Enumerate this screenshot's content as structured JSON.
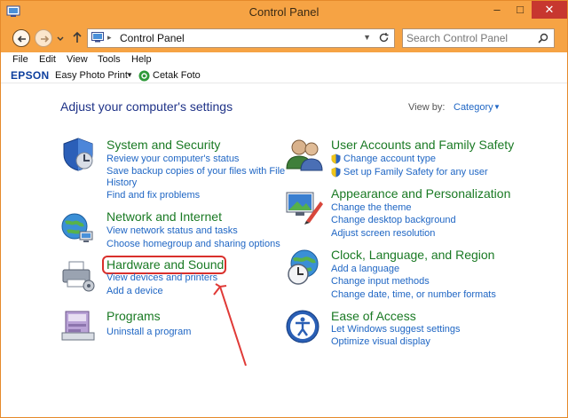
{
  "window": {
    "title": "Control Panel"
  },
  "address": {
    "path_label": "Control Panel"
  },
  "search": {
    "placeholder": "Search Control Panel"
  },
  "menu": {
    "file": "File",
    "edit": "Edit",
    "view": "View",
    "tools": "Tools",
    "help": "Help"
  },
  "epson": {
    "logo": "EPSON",
    "app": "Easy Photo Print",
    "foto": "Cetak Foto"
  },
  "heading": "Adjust your computer's settings",
  "view_by": {
    "label": "View by:",
    "value": "Category"
  },
  "categories": {
    "system": {
      "title": "System and Security",
      "links": [
        "Review your computer's status",
        "Save backup copies of your files with File",
        "History",
        "Find and fix problems"
      ]
    },
    "network": {
      "title": "Network and Internet",
      "links": [
        "View network status and tasks",
        "Choose homegroup and sharing options"
      ]
    },
    "hardware": {
      "title": "Hardware and Sound",
      "links": [
        "View devices and printers",
        "Add a device"
      ]
    },
    "programs": {
      "title": "Programs",
      "links": [
        "Uninstall a program"
      ]
    },
    "accounts": {
      "title": "User Accounts and Family Safety",
      "links": [
        "Change account type",
        "Set up Family Safety for any user"
      ]
    },
    "appearance": {
      "title": "Appearance and Personalization",
      "links": [
        "Change the theme",
        "Change desktop background",
        "Adjust screen resolution"
      ]
    },
    "clock": {
      "title": "Clock, Language, and Region",
      "links": [
        "Add a language",
        "Change input methods",
        "Change date, time, or number formats"
      ]
    },
    "ease": {
      "title": "Ease of Access",
      "links": [
        "Let Windows suggest settings",
        "Optimize visual display"
      ]
    }
  },
  "colors": {
    "titlebar": "#f6a344",
    "link": "#1f66c4",
    "category_title": "#1a7a24",
    "heading": "#1e3287",
    "highlight": "#d9302c"
  }
}
